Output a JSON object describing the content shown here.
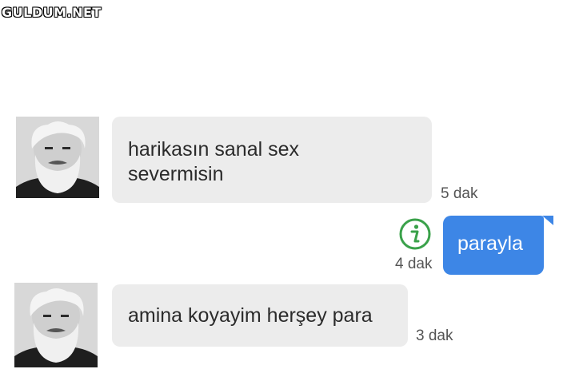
{
  "watermark": "GULDUM.NET",
  "messages": [
    {
      "side": "in",
      "lines": [
        "harikasın sanal sex",
        "severmisin"
      ],
      "time": "5 dak"
    },
    {
      "side": "out",
      "lines": [
        "parayla"
      ],
      "time": "4 dak",
      "status_icon": "info-icon"
    },
    {
      "side": "in",
      "lines": [
        "amina koyayim herşey para"
      ],
      "time": "3 dak"
    }
  ],
  "colors": {
    "incoming_bubble": "#ececec",
    "outgoing_bubble": "#3d86e6",
    "info_icon": "#3aa14a",
    "timestamp": "#555555"
  }
}
